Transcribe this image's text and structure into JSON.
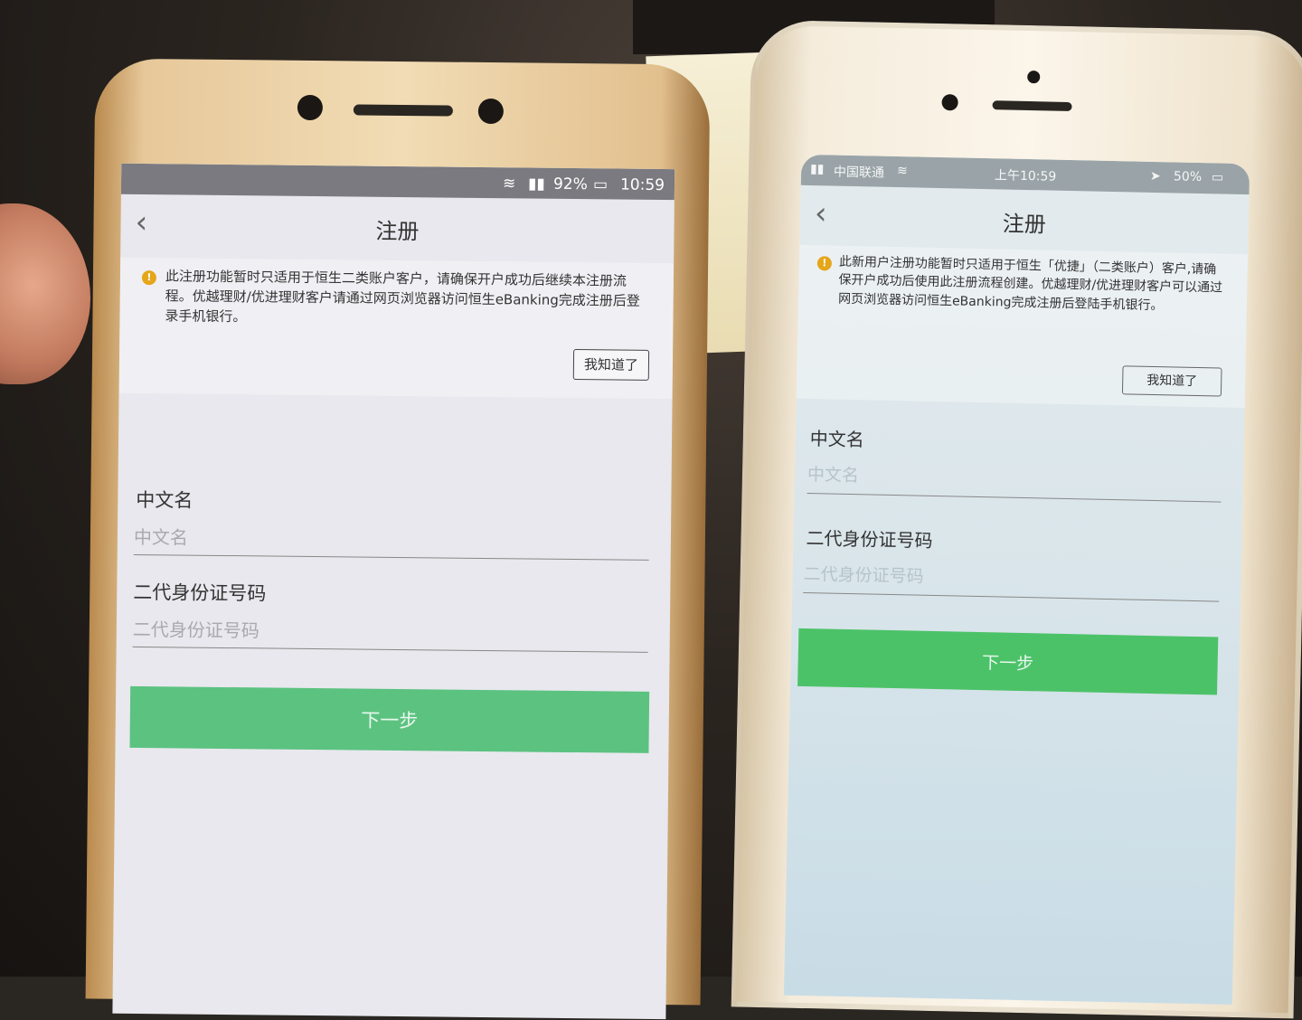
{
  "left_phone": {
    "status": {
      "battery": "92%",
      "time": "10:59"
    },
    "nav": {
      "back": "‹",
      "title": "注册"
    },
    "notice": {
      "text": "此注册功能暂时只适用于恒生二类账户客户，请确保开户成功后继续本注册流程。优越理财/优进理财客户请通过网页浏览器访问恒生eBanking完成注册后登录手机银行。",
      "ack_label": "我知道了"
    },
    "fields": {
      "name_label": "中文名",
      "name_placeholder": "中文名",
      "id_label": "二代身份证号码",
      "id_placeholder": "二代身份证号码"
    },
    "next_label": "下一步"
  },
  "right_phone": {
    "status": {
      "carrier": "中国联通",
      "time": "上午10:59",
      "battery": "50%"
    },
    "nav": {
      "back": "‹",
      "title": "注册"
    },
    "notice": {
      "text": "此新用户注册功能暂时只适用于恒生「优捷」（二类账户）客户,请确保开户成功后使用此注册流程创建。优越理财/优进理财客户可以通过网页浏览器访问恒生eBanking完成注册后登陆手机银行。",
      "ack_label": "我知道了"
    },
    "fields": {
      "name_label": "中文名",
      "name_placeholder": "中文名",
      "id_label": "二代身份证号码",
      "id_placeholder": "二代身份证号码"
    },
    "next_label": "下一步"
  },
  "colors": {
    "accent_green_left": "#5cc280",
    "accent_green_right": "#4cc268",
    "notice_icon": "#e5a61a"
  }
}
